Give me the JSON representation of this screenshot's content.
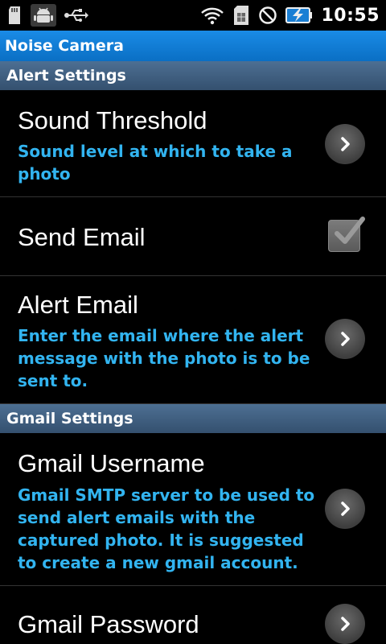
{
  "status_bar": {
    "time": "10:55",
    "left_icons": [
      "sd-card-icon",
      "android-debug-icon",
      "usb-icon"
    ],
    "right_icons": [
      "wifi-icon",
      "sim-icon",
      "no-signal-icon",
      "battery-charging-icon"
    ]
  },
  "app": {
    "title": "Noise Camera"
  },
  "categories": [
    {
      "header": "Alert Settings",
      "items": [
        {
          "title": "Sound Threshold",
          "summary": "Sound level at which to take a photo",
          "widget": "chevron"
        },
        {
          "title": "Send Email",
          "summary": "",
          "widget": "checkbox",
          "checked": true
        },
        {
          "title": "Alert Email",
          "summary": "Enter the email where the alert message with the photo is to be sent to.",
          "widget": "chevron"
        }
      ]
    },
    {
      "header": "Gmail Settings",
      "items": [
        {
          "title": "Gmail Username",
          "summary": "Gmail SMTP server to be used to send alert emails with the captured photo. It is suggested to create a new gmail account.",
          "widget": "chevron"
        },
        {
          "title": "Gmail Password",
          "summary": "",
          "widget": "chevron"
        }
      ]
    }
  ],
  "colors": {
    "title_bar": "#0a6fc4",
    "category_header": "#34506f",
    "summary_text": "#32b4f0"
  }
}
